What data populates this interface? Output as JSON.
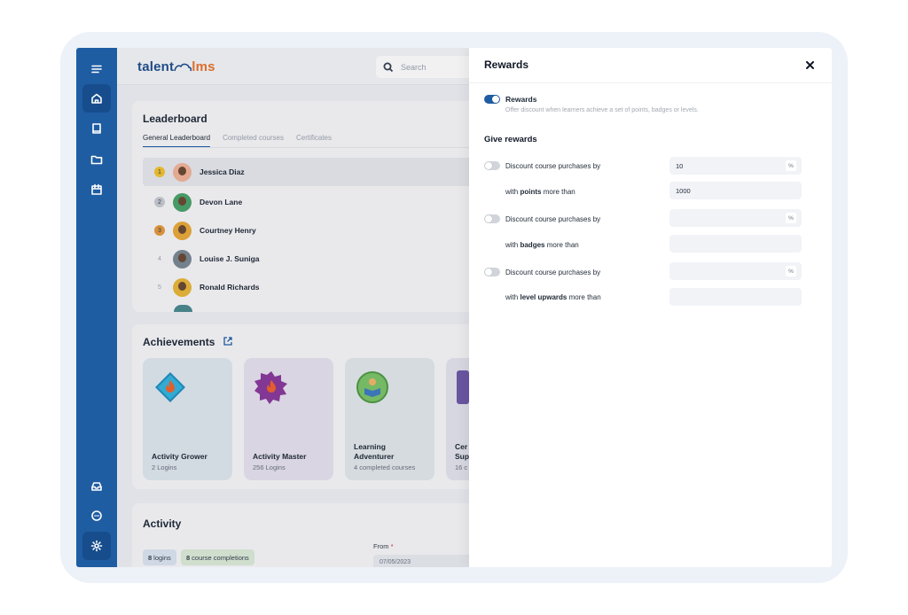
{
  "app": {
    "logo_left": "talent",
    "logo_right": "lms"
  },
  "search": {
    "placeholder": "Search"
  },
  "leaderboard": {
    "title": "Leaderboard",
    "tabs": [
      "General Leaderboard",
      "Completed courses",
      "Certificates"
    ],
    "rows": [
      {
        "rank": "1",
        "name": "Jessica Diaz"
      },
      {
        "rank": "2",
        "name": "Devon Lane"
      },
      {
        "rank": "3",
        "name": "Courtney Henry"
      },
      {
        "rank": "4",
        "name": "Louise J. Suniga"
      },
      {
        "rank": "5",
        "name": "Ronald Richards"
      }
    ]
  },
  "achievements": {
    "title": "Achievements",
    "cards": [
      {
        "name": "Activity Grower",
        "sub": "2 Logins"
      },
      {
        "name": "Activity Master",
        "sub": "256 Logins"
      },
      {
        "name": "Learning Adventurer",
        "sub": "4 completed courses"
      },
      {
        "name": "Cer Sup",
        "sub": "16 c"
      }
    ]
  },
  "activity": {
    "title": "Activity",
    "logins_count": "8",
    "logins_label": "logins",
    "completions_count": "8",
    "completions_label": "course completions",
    "from_label": "From",
    "from_required": "*",
    "from_value": "07/05/2023"
  },
  "rewards": {
    "title": "Rewards",
    "toggle_label": "Rewards",
    "toggle_on": true,
    "help": "Offer discount when learners achieve a set of points, badges or levels.",
    "section_title": "Give rewards",
    "discount_label": "Discount course purchases by",
    "percent": "%",
    "rules": [
      {
        "discount_value": "10",
        "with_prefix": "with",
        "criterion": "points",
        "suffix": "more than",
        "threshold": "1000"
      },
      {
        "discount_value": "",
        "with_prefix": "with",
        "criterion": "badges",
        "suffix": "more than",
        "threshold": ""
      },
      {
        "discount_value": "",
        "with_prefix": "with",
        "criterion": "level upwards",
        "suffix": "more than",
        "threshold": ""
      }
    ]
  },
  "colors": {
    "brand_blue": "#1f5da3",
    "brand_orange": "#e8732e",
    "gold": "#f2c230",
    "bronze": "#e59a3d"
  }
}
